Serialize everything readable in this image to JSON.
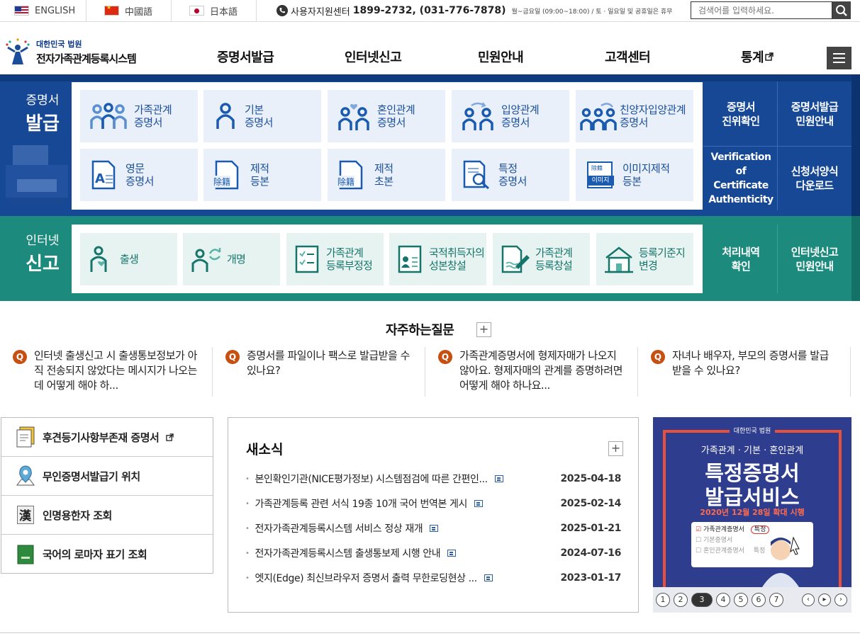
{
  "top_bar": {
    "languages": [
      {
        "label": "ENGLISH",
        "flag": "us-flag"
      },
      {
        "label": "中國語",
        "flag": "china-flag"
      },
      {
        "label": "日本語",
        "flag": "japan-flag"
      }
    ],
    "support_label": "사용자지원센터",
    "support_phone": "1899-2732, (031-776-7878)",
    "support_hours": "월~금요일 (09:00~18:00) / 토 · 일요일 및 공휴일은 휴무",
    "search_placeholder": "검색어를 입력하세요."
  },
  "header": {
    "logo_line1": "대한민국 법원",
    "logo_line2": "전자가족관계등록시스템",
    "nav": [
      "증명서발급",
      "인터넷신고",
      "민원안내",
      "고객센터",
      "통계"
    ]
  },
  "cert_band": {
    "title_line1": "증명서",
    "title_line2": "발급",
    "tiles": [
      {
        "label": "가족관계\n증명서",
        "icon": "family-icon"
      },
      {
        "label": "기본\n증명서",
        "icon": "person-icon"
      },
      {
        "label": "혼인관계\n증명서",
        "icon": "couple-heart-icon"
      },
      {
        "label": "입양관계\n증명서",
        "icon": "adoption-icon"
      },
      {
        "label": "친양자입양관계\n증명서",
        "icon": "full-adoption-icon"
      },
      {
        "label": "영문\n증명서",
        "icon": "english-doc-icon"
      },
      {
        "label": "제적\n등본",
        "icon": "removed-register-icon"
      },
      {
        "label": "제적\n초본",
        "icon": "removed-abstract-icon"
      },
      {
        "label": "특정\n증명서",
        "icon": "magnifier-doc-icon"
      },
      {
        "label": "이미지제적\n등본",
        "icon": "image-register-icon"
      }
    ],
    "tile_badges": {
      "jejeok": "除籍",
      "image_top": "除籍",
      "image_bottom": "이미지"
    },
    "side_links": [
      "증명서\n진위확인",
      "증명서발급\n민원안내",
      "Verification of\nCertificate\nAuthenticity",
      "신청서양식\n다운로드"
    ]
  },
  "report_band": {
    "title_line1": "인터넷",
    "title_line2": "신고",
    "tiles": [
      {
        "label": "출생",
        "icon": "birth-icon"
      },
      {
        "label": "개명",
        "icon": "rename-icon"
      },
      {
        "label": "가족관계\n등록부정정",
        "icon": "checklist-icon"
      },
      {
        "label": "국적취득자의\n성본창설",
        "icon": "nationality-icon"
      },
      {
        "label": "가족관계\n등록창설",
        "icon": "register-create-icon"
      },
      {
        "label": "등록기준지\n변경",
        "icon": "house-icon"
      }
    ],
    "side_links": [
      "처리내역\n확인",
      "인터넷신고\n민원안내"
    ]
  },
  "faq": {
    "title": "자주하는질문",
    "plus": "+",
    "q_badge": "Q",
    "items": [
      "인터넷 출생신고 시 출생통보정보가 아직 전송되지 않았다는 메시지가 나오는데 어떻게 해야 하...",
      "증명서를 파일이나 팩스로 발급받을 수 있나요?",
      "가족관계증명서에 형제자매가 나오지 않아요. 형제자매의 관계를 증명하려면 어떻게 해야 하나요...",
      "자녀나 배우자, 부모의 증명서를 발급 받을 수 있나요?"
    ]
  },
  "quick_links": [
    {
      "label": "후견등기사항부존재 증명서",
      "icon": "certificate-doc-icon"
    },
    {
      "label": "무인증명서발급기 위치",
      "icon": "map-pin-icon"
    },
    {
      "label": "인명용한자 조회",
      "icon": "hanja-book-icon"
    },
    {
      "label": "국어의 로마자 표기 조회",
      "icon": "green-book-icon"
    }
  ],
  "news": {
    "title": "새소식",
    "plus": "+",
    "items": [
      {
        "title": "본인확인기관(NICE평가정보) 시스템점검에 따른 간편인...",
        "date": "2025-04-18"
      },
      {
        "title": "가족관계등록 관련 서식 19종 10개 국어 번역본 게시",
        "date": "2025-02-14"
      },
      {
        "title": "전자가족관계등록시스템 서비스 정상 재개",
        "date": "2025-01-21"
      },
      {
        "title": "전자가족관계등록시스템 출생통보제 시행 안내",
        "date": "2024-07-16"
      },
      {
        "title": "엣지(Edge) 최신브라우저 증명서 출력 무한로딩현상 ...",
        "date": "2023-01-17"
      }
    ]
  },
  "banner": {
    "court": "대한민국 법원",
    "subtitle": "가족관계 · 기본 · 혼인관계",
    "headline1": "특정증명서",
    "headline2": "발급서비스",
    "date_line": "2020년 12월 28일 확대 시행",
    "form_rows": [
      {
        "label": "가족관계증명서",
        "tag": "특정",
        "checked": true
      },
      {
        "label": "기본증명서",
        "tag": "",
        "checked": false
      },
      {
        "label": "혼인관계증명서",
        "tag": "특정",
        "checked": false
      }
    ],
    "pages": [
      "1",
      "2",
      "3",
      "4",
      "5",
      "6",
      "7"
    ],
    "current_page": "3",
    "prev": "‹",
    "play": "▸",
    "next": "›"
  },
  "colors": {
    "cert_blue": "#164896",
    "report_teal": "#1c8a7d",
    "faq_orange": "#c64f12",
    "banner_navy": "#2f3d8f",
    "banner_red": "#e8503a"
  }
}
